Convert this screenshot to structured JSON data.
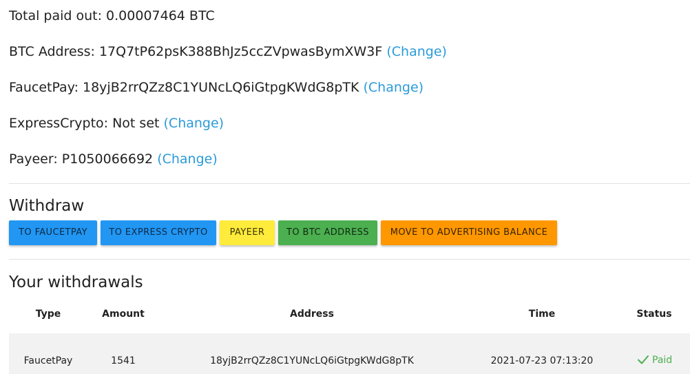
{
  "summary": {
    "total_paid_label": "Total paid out: 0.00007464 BTC"
  },
  "addresses": [
    {
      "label": "BTC Address: 17Q7tP62psK388BhJz5ccZVpwasBymXW3F",
      "change": "(Change)"
    },
    {
      "label": "FaucetPay: 18yjB2rrQZz8C1YUNcLQ6iGtpgKWdG8pTK",
      "change": "(Change)"
    },
    {
      "label": "ExpressCrypto: Not set",
      "change": "(Change)"
    },
    {
      "label": "Payeer: P1050066692",
      "change": "(Change)"
    }
  ],
  "withdraw": {
    "title": "Withdraw",
    "buttons": {
      "faucetpay": "TO FAUCETPAY",
      "express": "TO EXPRESS CRYPTO",
      "payeer": "PAYEER",
      "btc": "TO BTC ADDRESS",
      "advertising": "MOVE TO ADVERTISING BALANCE"
    },
    "colors": {
      "blue": "#2196f3",
      "yellow": "#ffeb3b",
      "green": "#4caf50",
      "orange": "#ff9800"
    }
  },
  "withdrawals": {
    "title": "Your withdrawals",
    "columns": [
      "Type",
      "Amount",
      "Address",
      "Time",
      "Status"
    ],
    "rows": [
      {
        "type": "FaucetPay",
        "amount": "1541",
        "address": "18yjB2rrQZz8C1YUNcLQ6iGtpgKWdG8pTK",
        "time": "2021-07-23 07:13:20",
        "status": "Paid",
        "status_icon": "check-icon"
      }
    ]
  }
}
